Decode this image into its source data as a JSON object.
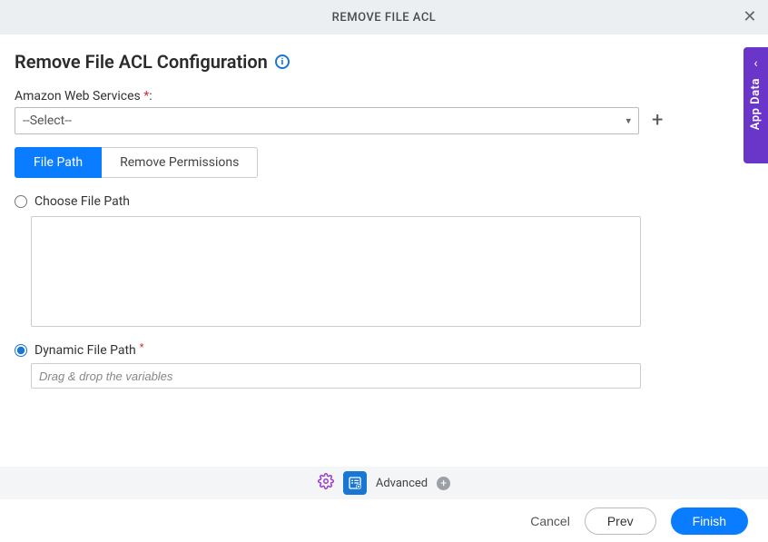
{
  "header": {
    "title": "REMOVE FILE ACL"
  },
  "page": {
    "title": "Remove File ACL Configuration"
  },
  "fields": {
    "aws_label": "Amazon Web Services ",
    "aws_required": "*",
    "aws_colon": ":",
    "aws_selected": "--Select--"
  },
  "tabs": {
    "file_path": "File Path",
    "remove_permissions": "Remove Permissions"
  },
  "options": {
    "choose_file_path": "Choose File Path",
    "dynamic_file_path": "Dynamic File Path",
    "dynamic_required": "*",
    "dynamic_placeholder": "Drag & drop the variables"
  },
  "side": {
    "label": "App Data"
  },
  "advanced": {
    "label": "Advanced"
  },
  "footer": {
    "cancel": "Cancel",
    "prev": "Prev",
    "finish": "Finish"
  }
}
